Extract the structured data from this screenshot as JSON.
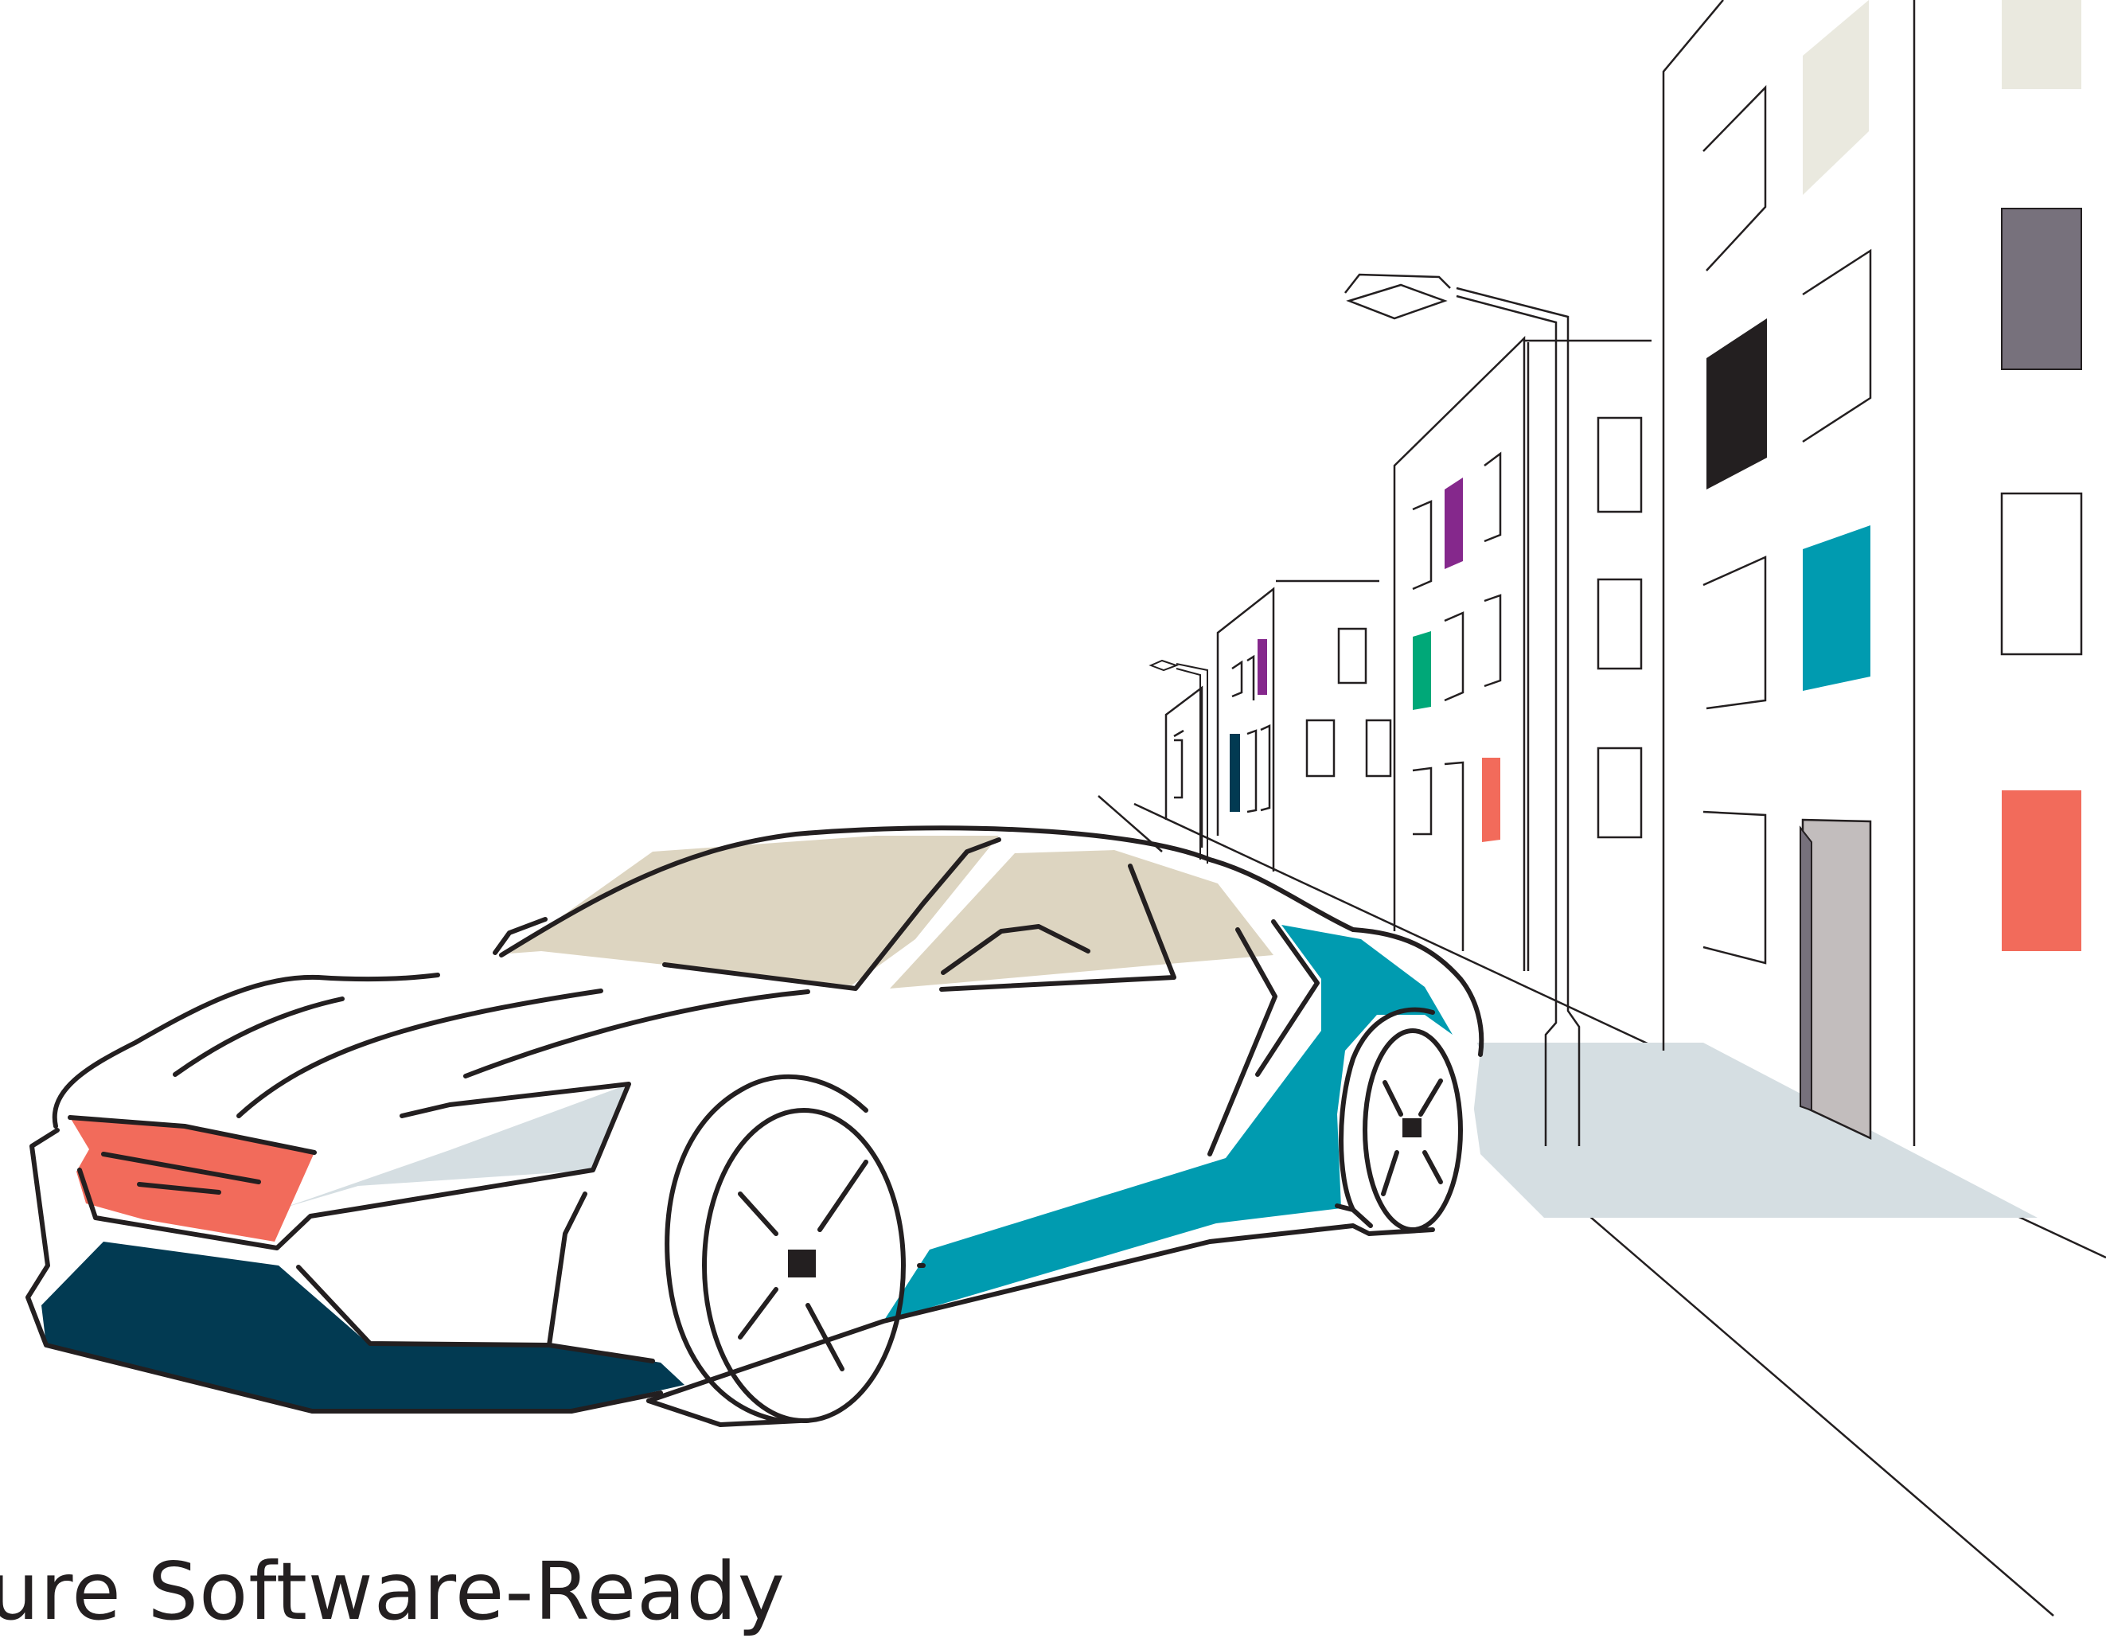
{
  "caption": "cure Software-Ready",
  "colors": {
    "ink": "#231f20",
    "coral": "#f26b5b",
    "teal": "#009bb0",
    "navy": "#023a52",
    "sand": "#ddd5c1",
    "mist": "#d5dee2",
    "slate": "#77717c",
    "cream": "#eae9df",
    "purple": "#85288c",
    "green": "#00a878",
    "door": "#c2bdbd"
  },
  "icons": [
    "sports-car-illustration",
    "street-lamp-icon",
    "building-icon",
    "city-street-icon"
  ]
}
